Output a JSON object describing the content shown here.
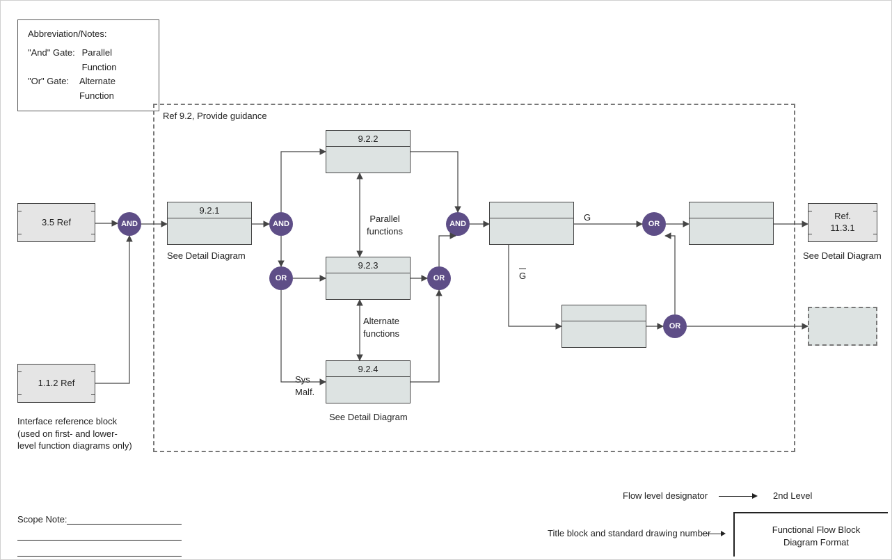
{
  "notes": {
    "title": "Abbreviation/Notes:",
    "line1_key": "\"And\" Gate:",
    "line1_val": "Parallel Function",
    "line2_key": "\"Or\" Gate:",
    "line2_val": "Alternate Function"
  },
  "container": {
    "label": "Ref 9.2, Provide guidance"
  },
  "refBlocks": {
    "left1": "3.5 Ref",
    "left2": "1.1.2 Ref",
    "right1": "Ref.\n11.3.1"
  },
  "blocks": {
    "b921": "9.2.1",
    "b922": "9.2.2",
    "b923": "9.2.3",
    "b924": "9.2.4"
  },
  "gates": {
    "and": "AND",
    "or": "OR"
  },
  "labels": {
    "seeDetail": "See Detail Diagram",
    "parallelFunctions": "Parallel\nfunctions",
    "alternateFunctions": "Alternate\nfunctions",
    "sysMalf": "Sys\nMalf.",
    "g": "G",
    "gbar": "G",
    "interfaceRef": "Interface reference block\n(used on first- and lower-\nlevel function diagrams only)",
    "scopeNote": "Scope Note:",
    "flowLevelDesignator": "Flow level designator",
    "secondLevel": "2nd Level",
    "titleBlockDrawing": "Title block and standard drawing number",
    "ffbdFormat": "Functional Flow Block\nDiagram Format"
  }
}
